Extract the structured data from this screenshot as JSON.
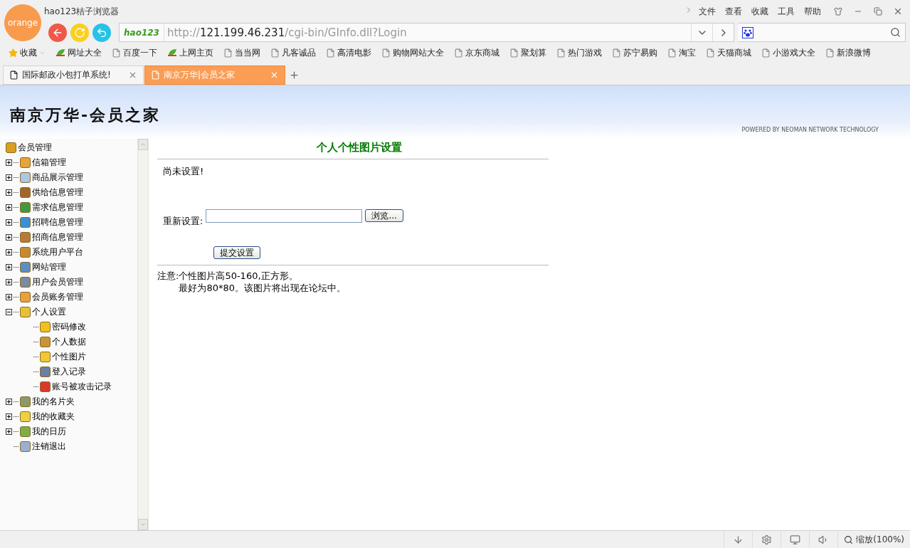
{
  "browser": {
    "logo": "orange",
    "title": "hao123桔子浏览器",
    "menu": [
      "文件",
      "查看",
      "收藏",
      "工具",
      "帮助"
    ],
    "address": {
      "brand": "hao123",
      "scheme": "http://",
      "host": "121.199.46.231",
      "path": "/cgi-bin/GInfo.dll?Login"
    },
    "favorites_label": "收藏",
    "bookmarks": [
      {
        "label": "网址大全",
        "kind": "hao"
      },
      {
        "label": "百度一下",
        "kind": "page"
      },
      {
        "label": "上网主页",
        "kind": "hao"
      },
      {
        "label": "当当网",
        "kind": "page"
      },
      {
        "label": "凡客诚品",
        "kind": "page"
      },
      {
        "label": "高清电影",
        "kind": "page"
      },
      {
        "label": "购物网站大全",
        "kind": "page"
      },
      {
        "label": "京东商城",
        "kind": "page"
      },
      {
        "label": "聚划算",
        "kind": "page"
      },
      {
        "label": "热门游戏",
        "kind": "page"
      },
      {
        "label": "苏宁易购",
        "kind": "page"
      },
      {
        "label": "淘宝",
        "kind": "page"
      },
      {
        "label": "天猫商城",
        "kind": "page"
      },
      {
        "label": "小游戏大全",
        "kind": "page"
      },
      {
        "label": "新浪微博",
        "kind": "page"
      }
    ],
    "tabs": [
      {
        "label": "国际邮政小包打单系统!",
        "selected": false
      },
      {
        "label": "南京万华|会员之家",
        "selected": true
      }
    ]
  },
  "site": {
    "title": "南京万华-会员之家",
    "powered_by": "POWERED BY NEOMAN NETWORK TECHNOLOGY"
  },
  "tree": {
    "label": "会员管理",
    "children": [
      {
        "label": "信箱管理",
        "expanded": false
      },
      {
        "label": "商品展示管理",
        "expanded": false
      },
      {
        "label": "供给信息管理",
        "expanded": false
      },
      {
        "label": "需求信息管理",
        "expanded": false
      },
      {
        "label": "招聘信息管理",
        "expanded": false
      },
      {
        "label": "招商信息管理",
        "expanded": false
      },
      {
        "label": "系统用户平台",
        "expanded": false
      },
      {
        "label": "网站管理",
        "expanded": false
      },
      {
        "label": "用户会员管理",
        "expanded": false
      },
      {
        "label": "会员账务管理",
        "expanded": false
      },
      {
        "label": "个人设置",
        "expanded": true,
        "children": [
          {
            "label": "密码修改"
          },
          {
            "label": "个人数据"
          },
          {
            "label": "个性图片"
          },
          {
            "label": "登入记录"
          },
          {
            "label": "账号被攻击记录"
          }
        ]
      },
      {
        "label": "我的名片夹",
        "expanded": false
      },
      {
        "label": "我的收藏夹",
        "expanded": false
      },
      {
        "label": "我的日历",
        "expanded": false
      },
      {
        "label": "注销退出"
      }
    ]
  },
  "form": {
    "heading": "个人个性图片设置",
    "status": "尚未设置!",
    "reset_label": "重新设置:",
    "browse_button": "浏览...",
    "submit_button": "提交设置",
    "note_label": "注意:",
    "note_lines": [
      "个性图片高50-160,正方形。",
      "最好为80*80。该图片将出现在论坛中。"
    ]
  },
  "status_bar": {
    "zoom": "缩放(100%)"
  }
}
